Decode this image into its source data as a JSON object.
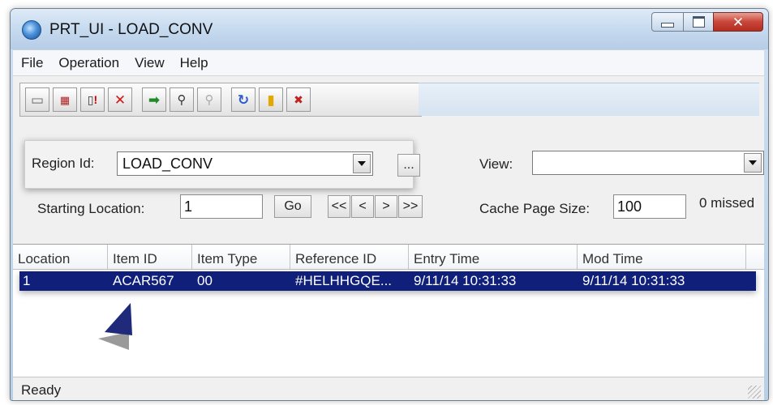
{
  "window": {
    "title": "PRT_UI - LOAD_CONV"
  },
  "menu": [
    "File",
    "Operation",
    "View",
    "Help"
  ],
  "toolbar": {
    "icons": [
      "new-icon",
      "calendar-icon",
      "document-alert-icon",
      "delete-icon",
      "go-arrow-icon",
      "find-icon",
      "find-disabled-icon",
      "refresh-icon",
      "lock-icon",
      "chart-delete-icon"
    ]
  },
  "region": {
    "label": "Region Id:",
    "value": "LOAD_CONV",
    "browse": "..."
  },
  "view": {
    "label": "View:",
    "value": ""
  },
  "nav": {
    "start_label": "Starting Location:",
    "start_value": "1",
    "go": "Go",
    "first": "<<",
    "prev": "<",
    "next": ">",
    "last": ">>",
    "cache_label": "Cache Page Size:",
    "cache_value": "100",
    "missed": "0 missed"
  },
  "table": {
    "columns": [
      "Location",
      "Item ID",
      "Item Type",
      "Reference ID",
      "Entry Time",
      "Mod Time"
    ],
    "rows": [
      [
        "1",
        "ACAR567",
        "00",
        "#HELHHGQE...",
        "9/11/14 10:31:33",
        "9/11/14 10:31:33"
      ]
    ]
  },
  "status": {
    "text": "Ready"
  },
  "colors": {
    "selection": "#0f1f7a",
    "annotation_arrow": "#1f2a7a"
  }
}
